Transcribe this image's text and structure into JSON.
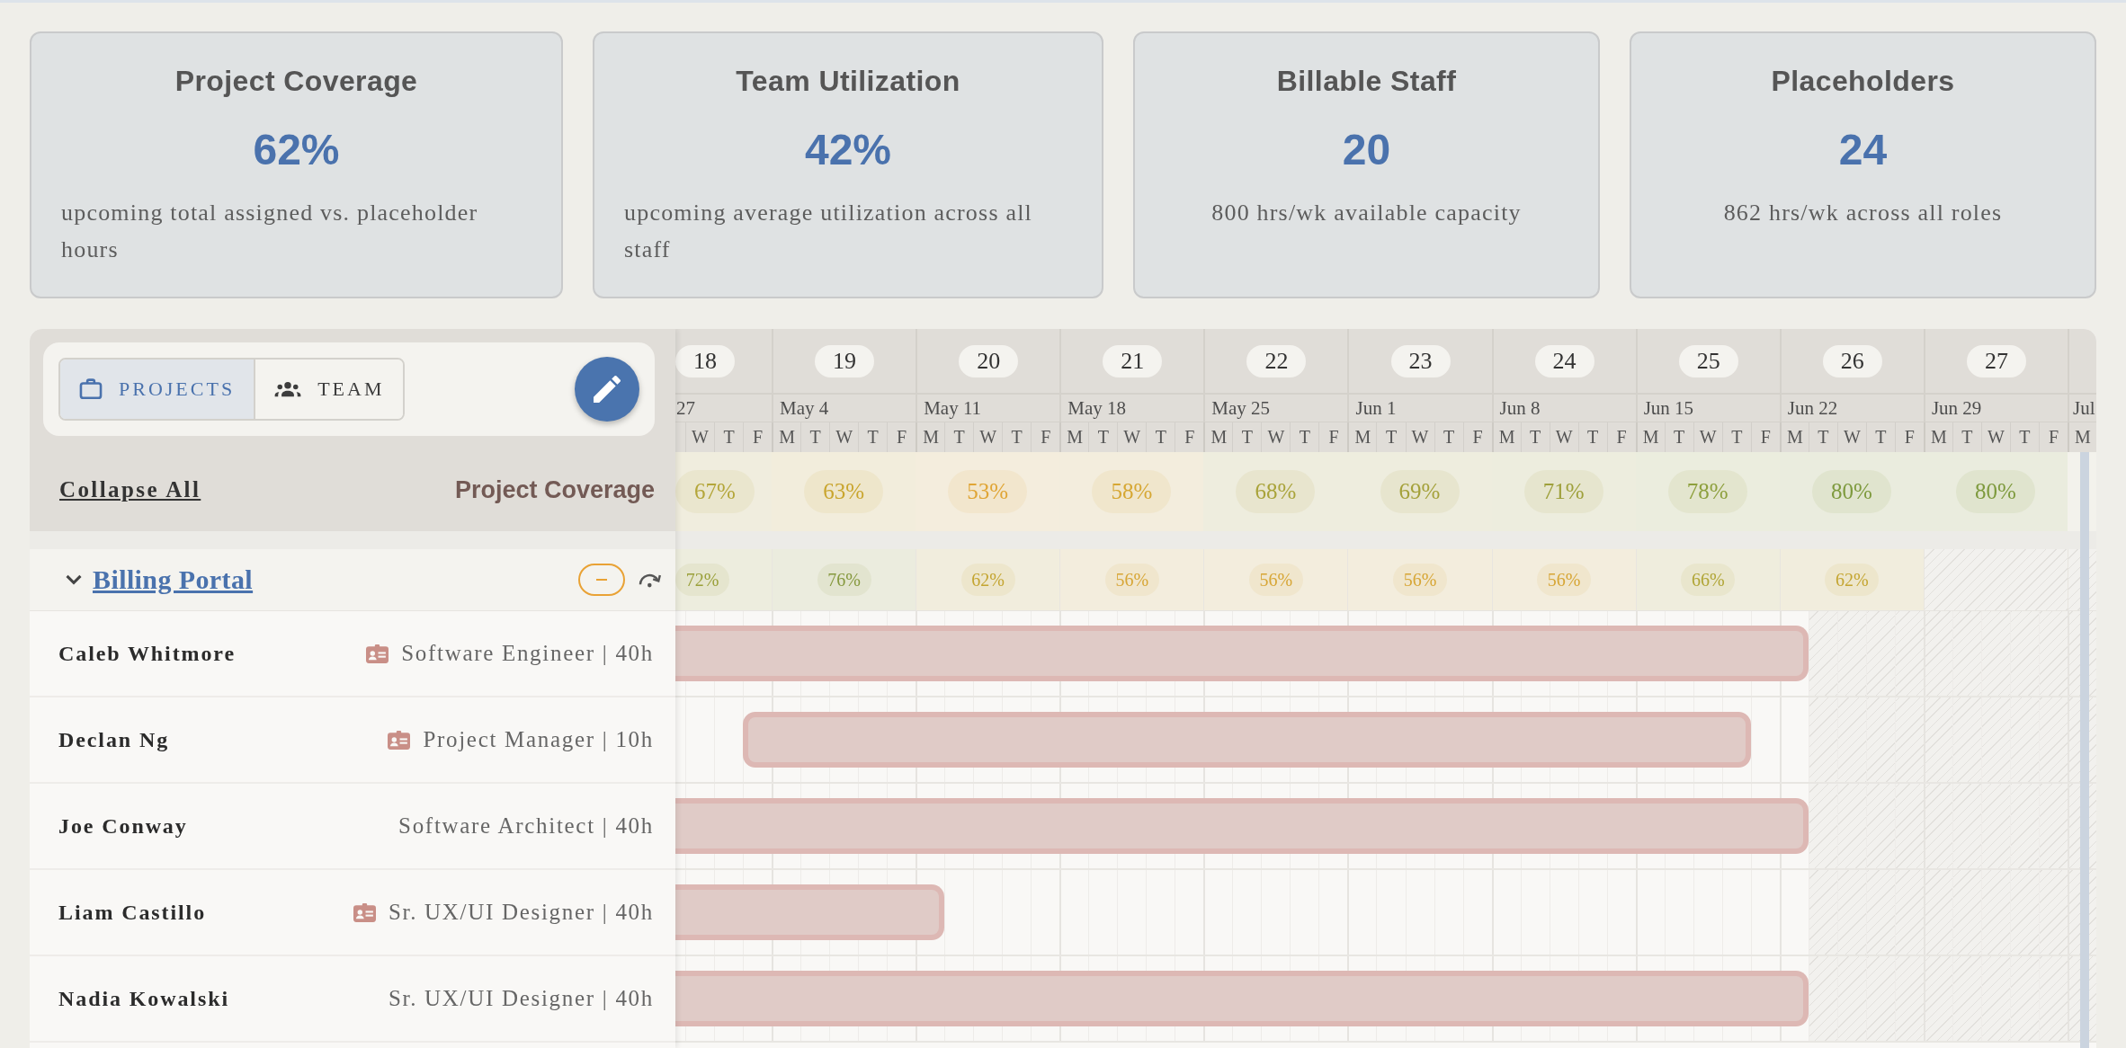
{
  "stats": [
    {
      "title": "Project Coverage",
      "value": "62%",
      "description": "upcoming total assigned vs. placeholder hours"
    },
    {
      "title": "Team Utilization",
      "value": "42%",
      "description": "upcoming average utilization across all staff"
    },
    {
      "title": "Billable Staff",
      "value": "20",
      "description": "800 hrs/wk available capacity"
    },
    {
      "title": "Placeholders",
      "value": "24",
      "description": "862 hrs/wk across all roles"
    }
  ],
  "view_tabs": [
    {
      "label": "PROJECTS",
      "selected": true
    },
    {
      "label": "TEAM",
      "selected": false
    }
  ],
  "collapse_all": "Collapse All",
  "coverage_heading": "Project Coverage",
  "weeks": [
    {
      "number": "18",
      "month": "27",
      "days": [
        "W",
        "T",
        "F"
      ],
      "today": false
    },
    {
      "number": "19",
      "month": "May 4",
      "days": [
        "M",
        "T",
        "W",
        "T",
        "F"
      ],
      "today": false
    },
    {
      "number": "20",
      "month": "May 11",
      "days": [
        "M",
        "T",
        "W",
        "T",
        "F"
      ],
      "today": false
    },
    {
      "number": "21",
      "month": "May 18",
      "days": [
        "M",
        "T",
        "W",
        "T",
        "F"
      ],
      "today": false
    },
    {
      "number": "22",
      "month": "May 25",
      "days": [
        "M",
        "T",
        "W",
        "T",
        "F"
      ],
      "today": false
    },
    {
      "number": "23",
      "month": "Jun 1",
      "days": [
        "M",
        "T",
        "W",
        "T",
        "F"
      ],
      "today": false
    },
    {
      "number": "24",
      "month": "Jun 8",
      "days": [
        "M",
        "T",
        "W",
        "T",
        "F"
      ],
      "today": false
    },
    {
      "number": "25",
      "month": "Jun 15",
      "days": [
        "M",
        "T",
        "W",
        "T",
        "F"
      ],
      "today": false
    },
    {
      "number": "26",
      "month": "Jun 22",
      "days": [
        "M",
        "T",
        "W",
        "T",
        "F"
      ],
      "today": false
    },
    {
      "number": "27",
      "month": "Jun 29",
      "days": [
        "M",
        "T",
        "W",
        "T",
        "F"
      ],
      "today": false
    },
    {
      "month": "Jul",
      "days": [
        "M"
      ],
      "today": true
    }
  ],
  "summary_coverage": [
    {
      "value": "67%",
      "color": "#b4a63a"
    },
    {
      "value": "63%",
      "color": "#c9a52e"
    },
    {
      "value": "53%",
      "color": "#e0a535"
    },
    {
      "value": "58%",
      "color": "#d6a733"
    },
    {
      "value": "68%",
      "color": "#a9a33a"
    },
    {
      "value": "69%",
      "color": "#a4a13a"
    },
    {
      "value": "71%",
      "color": "#9ea03b"
    },
    {
      "value": "78%",
      "color": "#8ea03e"
    },
    {
      "value": "80%",
      "color": "#7e9a3e"
    },
    {
      "value": "80%",
      "color": "#7e9a3e"
    }
  ],
  "projects": [
    {
      "name": "Billing Portal",
      "expanded": true,
      "coverage": [
        {
          "value": "72%",
          "color": "#9aa03a"
        },
        {
          "value": "76%",
          "color": "#86993f"
        },
        {
          "value": "62%",
          "color": "#c4a531"
        },
        {
          "value": "56%",
          "color": "#d7a636"
        },
        {
          "value": "56%",
          "color": "#d7a636"
        },
        {
          "value": "56%",
          "color": "#d7a636"
        },
        {
          "value": "56%",
          "color": "#d7a636"
        },
        {
          "value": "66%",
          "color": "#b0a535"
        },
        {
          "value": "62%",
          "color": "#c4a531"
        }
      ],
      "schedule_days": [
        true,
        true,
        true,
        true,
        true,
        true,
        true,
        true,
        true,
        true,
        true,
        true,
        true,
        true,
        true,
        true,
        true,
        true,
        true,
        true,
        true,
        true,
        true,
        true,
        true,
        true,
        true,
        true,
        true,
        true,
        true,
        true,
        true,
        true,
        true,
        true,
        true,
        true,
        true,
        false,
        false,
        false,
        false,
        false,
        false,
        false,
        false,
        false,
        false
      ],
      "members": [
        {
          "name": "Caleb Whitmore",
          "role": "Software Engineer | 40h",
          "id_badge": true,
          "booked": [
            true,
            true,
            true,
            true,
            true,
            true,
            true,
            true,
            true,
            true,
            true,
            true,
            true,
            true,
            true,
            true,
            true,
            true,
            true,
            true,
            true,
            true,
            true,
            true,
            true,
            true,
            true,
            true,
            true,
            true,
            true,
            true,
            true,
            true,
            true,
            true,
            true,
            true,
            true,
            false,
            false,
            false,
            false,
            false,
            false,
            false,
            false,
            false,
            false
          ]
        },
        {
          "name": "Declan Ng",
          "role": "Project Manager | 10h",
          "id_badge": true,
          "booked": [
            false,
            false,
            true,
            true,
            true,
            true,
            true,
            true,
            true,
            true,
            true,
            true,
            true,
            true,
            true,
            true,
            true,
            true,
            true,
            true,
            true,
            true,
            true,
            true,
            true,
            true,
            true,
            true,
            true,
            true,
            true,
            true,
            true,
            true,
            true,
            true,
            true,
            false,
            false,
            false,
            false,
            false,
            false,
            false,
            false,
            false,
            false,
            false,
            false
          ]
        },
        {
          "name": "Joe Conway",
          "role": "Software Architect | 40h",
          "id_badge": false,
          "booked": [
            true,
            true,
            true,
            true,
            true,
            true,
            true,
            true,
            true,
            true,
            true,
            true,
            true,
            true,
            true,
            true,
            true,
            true,
            true,
            true,
            true,
            true,
            true,
            true,
            true,
            true,
            true,
            true,
            true,
            true,
            true,
            true,
            true,
            true,
            true,
            true,
            true,
            true,
            true,
            false,
            false,
            false,
            false,
            false,
            false,
            false,
            false,
            false,
            false
          ]
        },
        {
          "name": "Liam Castillo",
          "role": "Sr. UX/UI Designer | 40h",
          "id_badge": true,
          "booked": [
            true,
            true,
            true,
            true,
            true,
            true,
            true,
            true,
            true,
            false,
            false,
            false,
            false,
            false,
            false,
            false,
            false,
            false,
            false,
            false,
            false,
            false,
            false,
            false,
            false,
            false,
            false,
            false,
            false,
            false,
            false,
            false,
            false,
            false,
            false,
            false,
            false,
            false,
            false,
            false,
            false,
            false,
            false,
            false,
            false,
            false,
            false,
            false,
            false
          ]
        },
        {
          "name": "Nadia Kowalski",
          "role": "Sr. UX/UI Designer | 40h",
          "id_badge": false,
          "booked": [
            true,
            true,
            true,
            true,
            true,
            true,
            true,
            true,
            true,
            true,
            true,
            true,
            true,
            true,
            true,
            true,
            true,
            true,
            true,
            true,
            true,
            true,
            true,
            true,
            true,
            true,
            true,
            true,
            true,
            true,
            true,
            true,
            true,
            true,
            true,
            true,
            true,
            true,
            true,
            false,
            false,
            false,
            false,
            false,
            false,
            false,
            false,
            false,
            false
          ]
        }
      ]
    }
  ]
}
